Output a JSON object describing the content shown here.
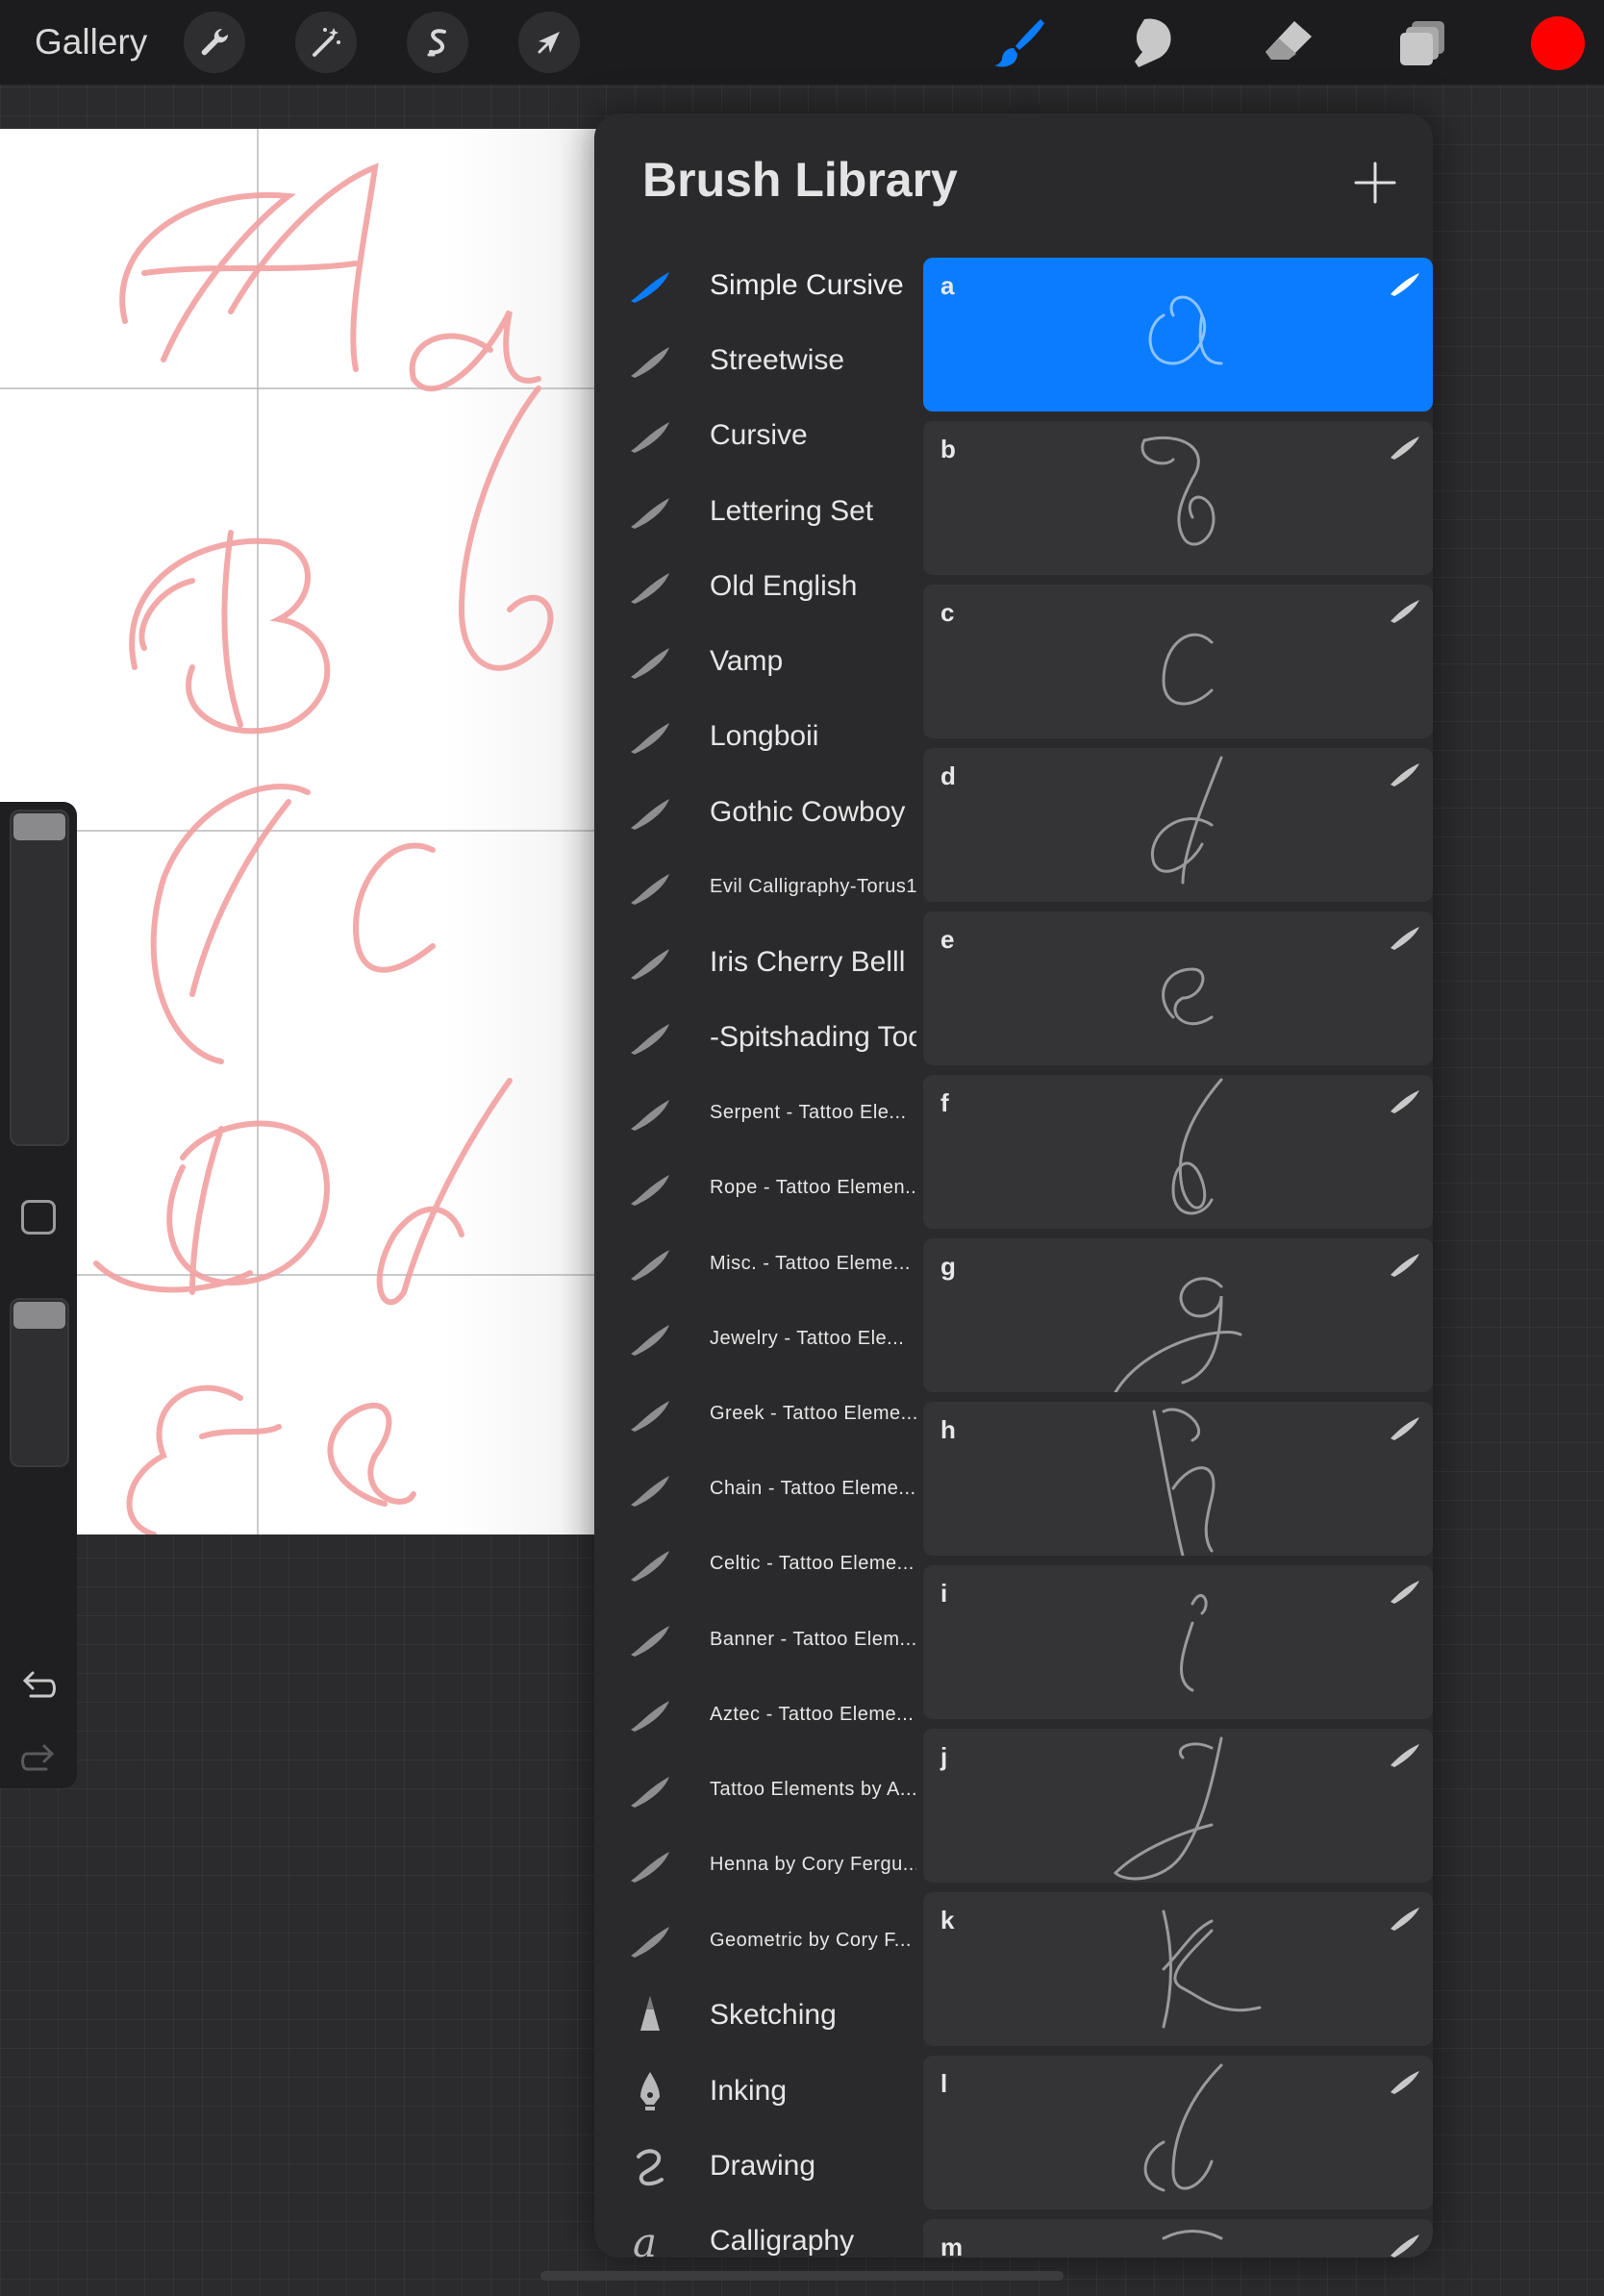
{
  "topbar": {
    "gallery_label": "Gallery",
    "left_tools": [
      {
        "name": "actions",
        "icon": "wrench-icon"
      },
      {
        "name": "adjustments",
        "icon": "magic-wand-icon"
      },
      {
        "name": "selection",
        "icon": "selection-s-icon"
      },
      {
        "name": "transform",
        "icon": "arrow-cursor-icon"
      }
    ],
    "right_tools": [
      {
        "name": "brush",
        "icon": "brush-icon",
        "active": true
      },
      {
        "name": "smudge",
        "icon": "smudge-finger-icon",
        "active": false
      },
      {
        "name": "eraser",
        "icon": "eraser-icon",
        "active": false
      },
      {
        "name": "layers",
        "icon": "layers-icon",
        "active": false
      }
    ],
    "current_color": "#ff0000",
    "active_tool_color": "#0a7cff"
  },
  "canvas": {
    "ink_color": "#f2a0a0"
  },
  "sidebar": {
    "brush_size_icon": "slider-icon",
    "opacity_icon": "slider-icon",
    "modify_icon": "square-modify-icon",
    "undo_icon": "undo-arrow-icon",
    "redo_icon": "redo-arrow-icon"
  },
  "brush_library": {
    "title": "Brush Library",
    "add_icon": "plus-icon",
    "sets": [
      {
        "label": "Simple Cursive",
        "size": "big",
        "icon": "brush-stroke-icon",
        "active": true
      },
      {
        "label": "Streetwise",
        "size": "big",
        "icon": "brush-stroke-icon"
      },
      {
        "label": " Cursive",
        "size": "big",
        "icon": "brush-stroke-icon"
      },
      {
        "label": "Lettering Set",
        "size": "big",
        "icon": "brush-stroke-icon"
      },
      {
        "label": "Old English",
        "size": "big",
        "icon": "brush-stroke-icon"
      },
      {
        "label": "Vamp",
        "size": "big",
        "icon": "brush-stroke-icon"
      },
      {
        "label": "Longboii",
        "size": "big",
        "icon": "brush-stroke-icon"
      },
      {
        "label": "Gothic Cowboy",
        "size": "big",
        "icon": "brush-stroke-icon"
      },
      {
        "label": "Evil Calligraphy-Torus1",
        "size": "small",
        "icon": "brush-stroke-icon"
      },
      {
        "label": "Iris Cherry Belll",
        "size": "big",
        "icon": "brush-stroke-icon"
      },
      {
        "label": "-Spitshading Tool-",
        "size": "big",
        "icon": "brush-stroke-icon"
      },
      {
        "label": "Serpent - Tattoo Ele...",
        "size": "small",
        "icon": "brush-stroke-icon"
      },
      {
        "label": "Rope - Tattoo Elemen...",
        "size": "small",
        "icon": "brush-stroke-icon"
      },
      {
        "label": "Misc. - Tattoo Eleme...",
        "size": "small",
        "icon": "brush-stroke-icon"
      },
      {
        "label": "Jewelry - Tattoo Ele...",
        "size": "small",
        "icon": "brush-stroke-icon"
      },
      {
        "label": "Greek - Tattoo Eleme...",
        "size": "small",
        "icon": "brush-stroke-icon"
      },
      {
        "label": "Chain - Tattoo Eleme...",
        "size": "small",
        "icon": "brush-stroke-icon"
      },
      {
        "label": "Celtic - Tattoo Eleme...",
        "size": "small",
        "icon": "brush-stroke-icon"
      },
      {
        "label": "Banner - Tattoo Elem...",
        "size": "small",
        "icon": "brush-stroke-icon"
      },
      {
        "label": "Aztec - Tattoo Eleme...",
        "size": "small",
        "icon": "brush-stroke-icon"
      },
      {
        "label": "Tattoo Elements by A...",
        "size": "small",
        "icon": "brush-stroke-icon"
      },
      {
        "label": "Henna by Cory Fergu...",
        "size": "small",
        "icon": "brush-stroke-icon"
      },
      {
        "label": "Geometric by Cory F...",
        "size": "small",
        "icon": "brush-stroke-icon"
      },
      {
        "label": "Sketching",
        "size": "big",
        "icon": "pencil-tip-icon"
      },
      {
        "label": "Inking",
        "size": "big",
        "icon": "pen-nib-icon"
      },
      {
        "label": "Drawing",
        "size": "big",
        "icon": "squiggle-icon"
      },
      {
        "label": "Calligraphy",
        "size": "big",
        "icon": "calligraphy-a-icon"
      }
    ],
    "brushes": [
      {
        "letter": "a",
        "selected": true
      },
      {
        "letter": "b"
      },
      {
        "letter": "c"
      },
      {
        "letter": "d"
      },
      {
        "letter": "e"
      },
      {
        "letter": "f"
      },
      {
        "letter": "g"
      },
      {
        "letter": "h"
      },
      {
        "letter": "i"
      },
      {
        "letter": "j"
      },
      {
        "letter": "k"
      },
      {
        "letter": "l"
      },
      {
        "letter": "m"
      }
    ]
  }
}
